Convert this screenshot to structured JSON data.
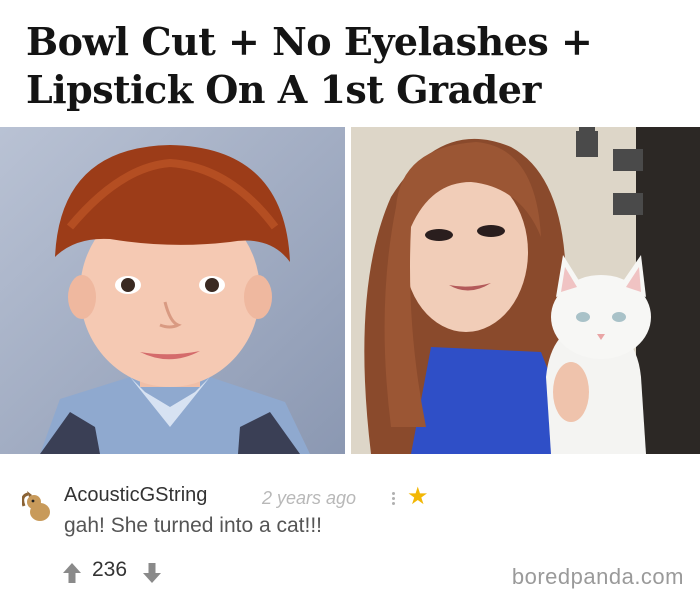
{
  "post": {
    "title": "Bowl Cut + No Eyelashes + Lipstick On A 1st Grader"
  },
  "photos": {
    "left_description_icon": "child-portrait",
    "right_description_icon": "woman-with-cat"
  },
  "comment": {
    "username": "AcousticGString",
    "time_ago": "2 years ago",
    "text": "gah! She turned into a cat!!!",
    "votes": "236",
    "avatar_icon": "squirrel-avatar-icon",
    "star_icon": "star-icon",
    "star_glyph": "★",
    "star_color": "#f2b705"
  },
  "watermark": "boredpanda.com"
}
